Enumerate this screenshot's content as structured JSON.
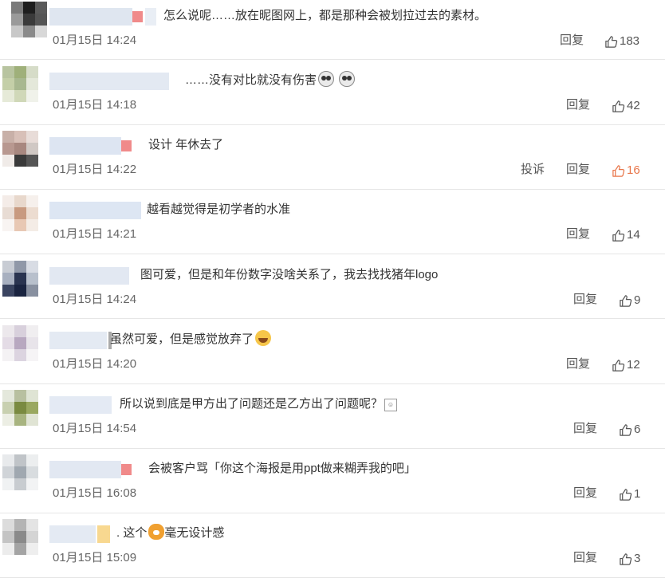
{
  "labels": {
    "reply": "回复",
    "report": "投诉"
  },
  "colors": {
    "liked": "#e8764a",
    "text": "#333333",
    "meta": "#666666",
    "divider": "#e6e6e6"
  },
  "comments": [
    {
      "text": "怎么说呢……放在昵图网上，都是那种会被划拉过去的素材。",
      "time": "01月15日 14:24",
      "likes": "183",
      "emoji": ""
    },
    {
      "text": "……没有对比就没有伤害",
      "time": "01月15日 14:18",
      "likes": "42",
      "emoji": "shock-face-icon x2"
    },
    {
      "text": "设计 年休去了",
      "time": "01月15日 14:22",
      "likes": "16",
      "liked": true
    },
    {
      "text": "越看越觉得是初学者的水准",
      "time": "01月15日 14:21",
      "likes": "14"
    },
    {
      "text": "图可爱，但是和年份数字没啥关系了，我去找找猪年logo",
      "time": "01月15日 14:24",
      "likes": "9"
    },
    {
      "text": "虽然可爱，但是感觉放弃了",
      "time": "01月15日 14:20",
      "likes": "12",
      "emoji": "laughing-tears-icon"
    },
    {
      "text": "所以说到底是甲方出了问题还是乙方出了问题呢？",
      "time": "01月15日 14:54",
      "likes": "6",
      "emoji": "small-emoticon-icon"
    },
    {
      "text": "会被客户骂「你这个海报是用ppt做来糊弄我的吧」",
      "time": "01月15日 16:08",
      "likes": "1"
    },
    {
      "text": "这个",
      "text_after": "毫无设计感",
      "time": "01月15日 15:09",
      "likes": "3",
      "emoji": "tiger-face-icon"
    }
  ]
}
